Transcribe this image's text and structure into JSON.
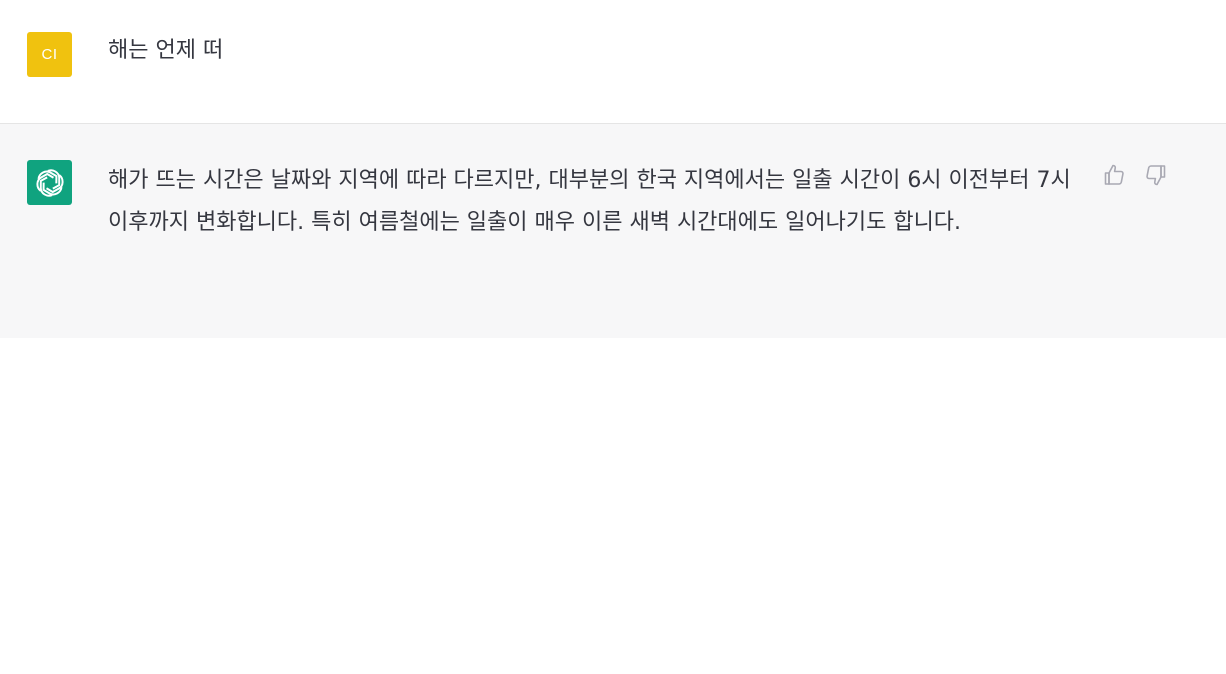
{
  "conversation": {
    "user_message": {
      "avatar_initials": "CI",
      "text": "해는 언제 떠"
    },
    "assistant_message": {
      "avatar_icon": "openai-logo-icon",
      "text": "해가 뜨는 시간은 날짜와 지역에 따라 다르지만, 대부분의 한국 지역에서는 일출 시간이 6시 이전부터 7시 이후까지 변화합니다. 특히 여름철에는 일출이 매우 이른 새벽 시간대에도 일어나기도 합니다.",
      "feedback": {
        "thumbs_up_icon": "thumbs-up-icon",
        "thumbs_down_icon": "thumbs-down-icon"
      }
    }
  },
  "colors": {
    "user_avatar_bg": "#f0c20f",
    "assistant_avatar_bg": "#10a37f",
    "assistant_row_bg": "#f7f7f8",
    "text": "#353740",
    "icon": "#a9a9b3"
  }
}
